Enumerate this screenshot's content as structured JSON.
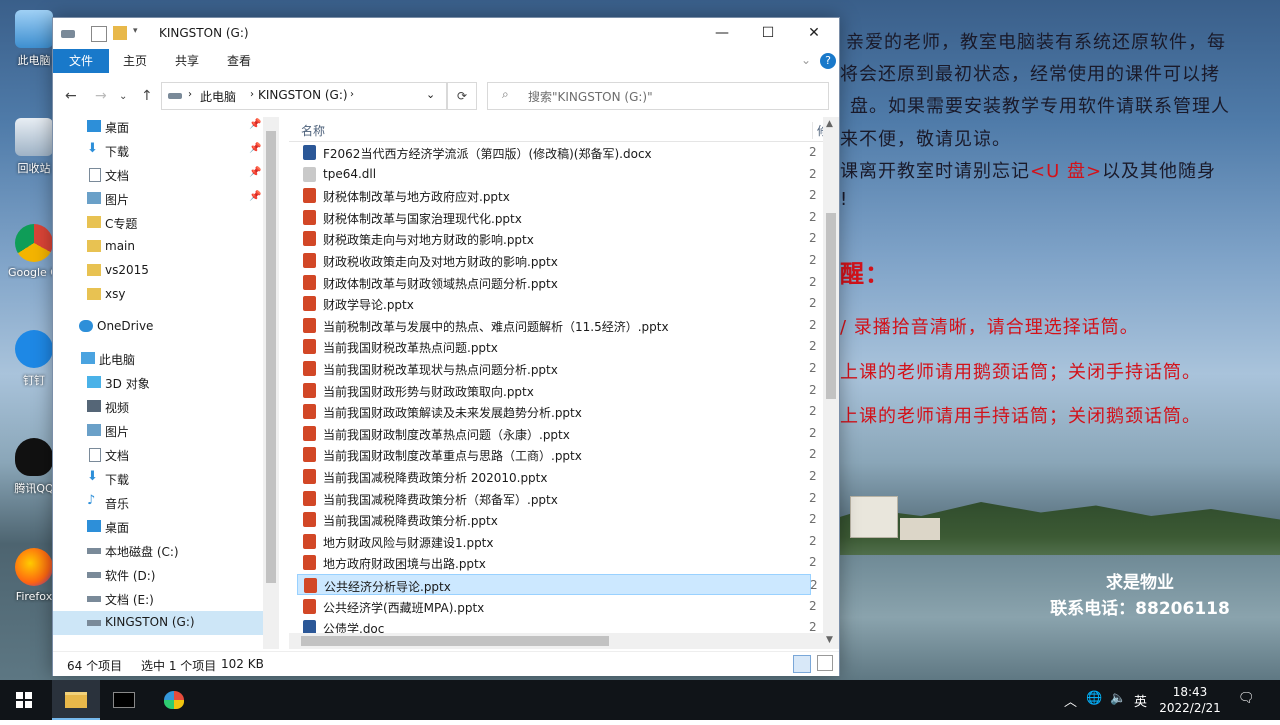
{
  "wallpaper": {
    "notice_lines": [
      "亲爱的老师，教室电脑装有系统还原软件，每",
      "将会还原到最初状态，经常使用的课件可以拷",
      "盘。如果需要安装教学专用软件请联系管理人",
      "来不便，敬请见谅。",
      "课离开教室时请别忘记",
      "<U 盘>",
      "以及其他随身",
      "!",
      "醒：",
      "/ 录播拾音清晰，请合理选择话筒。",
      "上课的老师请用鹅颈话筒；关闭手持话筒。",
      "上课的老师请用手持话筒；关闭鹅颈话筒。"
    ],
    "contact_name": "求是物业",
    "contact_phone": "联系电话：88206118"
  },
  "desktop_icons": [
    {
      "label": "此电脑",
      "icon": "computer-icon"
    },
    {
      "label": "回收站",
      "icon": "recycle-bin-icon"
    },
    {
      "label": "Google Chrome",
      "icon": "chrome-icon"
    },
    {
      "label": "钉钉",
      "icon": "dingtalk-icon"
    },
    {
      "label": "腾讯QQ",
      "icon": "qq-icon"
    },
    {
      "label": "Firefox",
      "icon": "firefox-icon"
    }
  ],
  "window": {
    "title": "KINGSTON (G:)",
    "controls": {
      "minimize": "—",
      "maximize": "☐",
      "close": "✕"
    },
    "ribbon_tabs": [
      "文件",
      "主页",
      "共享",
      "查看"
    ],
    "address": {
      "root": "此电脑",
      "current": "KINGSTON (G:)"
    },
    "search_placeholder": "搜索\"KINGSTON (G:)\"",
    "nav": [
      {
        "label": "桌面",
        "pinned": true
      },
      {
        "label": "下载",
        "pinned": true
      },
      {
        "label": "文档",
        "pinned": true
      },
      {
        "label": "图片",
        "pinned": true
      },
      {
        "label": "C专题",
        "pinned": false
      },
      {
        "label": "main",
        "pinned": false
      },
      {
        "label": "vs2015",
        "pinned": false
      },
      {
        "label": "xsy",
        "pinned": false
      },
      {
        "label": "OneDrive",
        "pinned": false
      },
      {
        "label": "此电脑",
        "pinned": false
      },
      {
        "label": "3D 对象",
        "pinned": false
      },
      {
        "label": "视频",
        "pinned": false
      },
      {
        "label": "图片",
        "pinned": false
      },
      {
        "label": "文档",
        "pinned": false
      },
      {
        "label": "下载",
        "pinned": false
      },
      {
        "label": "音乐",
        "pinned": false
      },
      {
        "label": "桌面",
        "pinned": false
      },
      {
        "label": "本地磁盘 (C:)",
        "pinned": false
      },
      {
        "label": "软件 (D:)",
        "pinned": false
      },
      {
        "label": "文档 (E:)",
        "pinned": false
      },
      {
        "label": "KINGSTON (G:)",
        "pinned": false
      }
    ],
    "columns": {
      "name": "名称",
      "modified": "修"
    },
    "files": [
      {
        "name": "F2062当代西方经济学流派（第四版）(修改稿)(郑备军).docx",
        "type": "docx",
        "date": "2"
      },
      {
        "name": "tpe64.dll",
        "type": "dll",
        "date": "2"
      },
      {
        "name": "财税体制改革与地方政府应对.pptx",
        "type": "pptx",
        "date": "2"
      },
      {
        "name": "财税体制改革与国家治理现代化.pptx",
        "type": "pptx",
        "date": "2"
      },
      {
        "name": "财税政策走向与对地方财政的影响.pptx",
        "type": "pptx",
        "date": "2"
      },
      {
        "name": "财政税收政策走向及对地方财政的影响.pptx",
        "type": "pptx",
        "date": "2"
      },
      {
        "name": "财政体制改革与财政领域热点问题分析.pptx",
        "type": "pptx",
        "date": "2"
      },
      {
        "name": "财政学导论.pptx",
        "type": "pptx",
        "date": "2"
      },
      {
        "name": "当前税制改革与发展中的热点、难点问题解析（11.5经济）.pptx",
        "type": "pptx",
        "date": "2"
      },
      {
        "name": "当前我国财税改革热点问题.pptx",
        "type": "pptx",
        "date": "2"
      },
      {
        "name": "当前我国财税改革现状与热点问题分析.pptx",
        "type": "pptx",
        "date": "2"
      },
      {
        "name": "当前我国财政形势与财政政策取向.pptx",
        "type": "pptx",
        "date": "2"
      },
      {
        "name": "当前我国财政政策解读及未来发展趋势分析.pptx",
        "type": "pptx",
        "date": "2"
      },
      {
        "name": "当前我国财政制度改革热点问题（永康）.pptx",
        "type": "pptx",
        "date": "2"
      },
      {
        "name": "当前我国财政制度改革重点与思路（工商）.pptx",
        "type": "pptx",
        "date": "2"
      },
      {
        "name": "当前我国减税降费政策分析 202010.pptx",
        "type": "pptx",
        "date": "2"
      },
      {
        "name": "当前我国减税降费政策分析（郑备军）.pptx",
        "type": "pptx",
        "date": "2"
      },
      {
        "name": "当前我国减税降费政策分析.pptx",
        "type": "pptx",
        "date": "2"
      },
      {
        "name": "地方财政风险与财源建设1.pptx",
        "type": "pptx",
        "date": "2"
      },
      {
        "name": "地方政府财政困境与出路.pptx",
        "type": "pptx",
        "date": "2"
      },
      {
        "name": "公共经济分析导论.pptx",
        "type": "pptx",
        "date": "2",
        "selected": true
      },
      {
        "name": "公共经济学(西藏班MPA).pptx",
        "type": "pptx",
        "date": "2"
      },
      {
        "name": "公债学.doc",
        "type": "doc",
        "date": "2"
      }
    ],
    "status": {
      "count": "64 个项目",
      "selection": "选中 1 个项目",
      "size": "102 KB"
    }
  },
  "taskbar": {
    "ime": "英",
    "time": "18:43",
    "date": "2022/2/21"
  },
  "colors": {
    "accent": "#1979ca",
    "selection": "#cce8ff",
    "pptx": "#d24726",
    "docx": "#2b5797",
    "notice_red": "#d2121a"
  }
}
